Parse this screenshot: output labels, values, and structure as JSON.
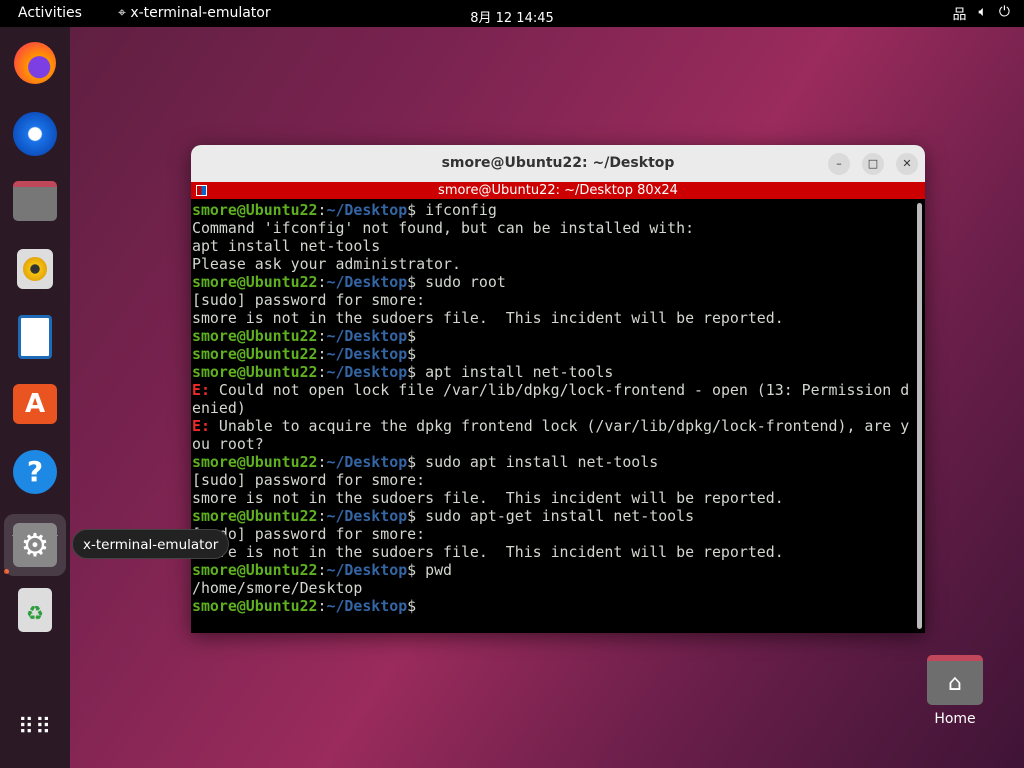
{
  "topbar": {
    "activities": "Activities",
    "app": "x-terminal-emulator",
    "clock": "8月 12 14:45",
    "tray": [
      "network-icon",
      "volume-icon",
      "power-icon"
    ]
  },
  "dock": {
    "items": [
      "firefox",
      "thunderbird",
      "files",
      "rhythmbox",
      "libreoffice-writer",
      "app-center",
      "help",
      "settings",
      "trash"
    ],
    "tooltip": "x-terminal-emulator",
    "apps_grid": "show-apps"
  },
  "window": {
    "title": "smore@Ubuntu22: ~/Desktop",
    "xterm_title": "smore@Ubuntu22: ~/Desktop 80x24",
    "min": "–",
    "max": "□",
    "close": "✕"
  },
  "terminal": {
    "lines": [
      [
        [
          "g",
          "smore@Ubuntu22"
        ],
        [
          "",
          "​:"
        ],
        [
          "b",
          "~/Desktop"
        ],
        [
          "",
          "$ ifconfig"
        ]
      ],
      [
        [
          "",
          "Command 'ifconfig' not found, but can be installed with:"
        ]
      ],
      [
        [
          "",
          "apt install net-tools"
        ]
      ],
      [
        [
          "",
          "Please ask your administrator."
        ]
      ],
      [
        [
          "g",
          "smore@Ubuntu22"
        ],
        [
          "",
          ":"
        ],
        [
          "b",
          "~/Desktop"
        ],
        [
          "",
          "$ sudo root"
        ]
      ],
      [
        [
          "",
          "[sudo] password for smore:"
        ]
      ],
      [
        [
          "",
          "smore is not in the sudoers file.  This incident will be reported."
        ]
      ],
      [
        [
          "g",
          "smore@Ubuntu22"
        ],
        [
          "",
          ":"
        ],
        [
          "b",
          "~/Desktop"
        ],
        [
          "",
          "$"
        ]
      ],
      [
        [
          "g",
          "smore@Ubuntu22"
        ],
        [
          "",
          ":"
        ],
        [
          "b",
          "~/Desktop"
        ],
        [
          "",
          "$"
        ]
      ],
      [
        [
          "g",
          "smore@Ubuntu22"
        ],
        [
          "",
          ":"
        ],
        [
          "b",
          "~/Desktop"
        ],
        [
          "",
          "$ apt install net-tools"
        ]
      ],
      [
        [
          "r",
          "E: "
        ],
        [
          "",
          "Could not open lock file /var/lib/dpkg/lock-frontend - open (13: Permission d"
        ]
      ],
      [
        [
          "",
          "enied)"
        ]
      ],
      [
        [
          "r",
          "E: "
        ],
        [
          "",
          "Unable to acquire the dpkg frontend lock (/var/lib/dpkg/lock-frontend), are y"
        ]
      ],
      [
        [
          "",
          "ou root?"
        ]
      ],
      [
        [
          "g",
          "smore@Ubuntu22"
        ],
        [
          "",
          ":"
        ],
        [
          "b",
          "~/Desktop"
        ],
        [
          "",
          "$ sudo apt install net-tools"
        ]
      ],
      [
        [
          "",
          "[sudo] password for smore:"
        ]
      ],
      [
        [
          "",
          "smore is not in the sudoers file.  This incident will be reported."
        ]
      ],
      [
        [
          "g",
          "smore@Ubuntu22"
        ],
        [
          "",
          ":"
        ],
        [
          "b",
          "~/Desktop"
        ],
        [
          "",
          "$ sudo apt-get install net-tools"
        ]
      ],
      [
        [
          "",
          "[sudo] password for smore:"
        ]
      ],
      [
        [
          "",
          "smore is not in the sudoers file.  This incident will be reported."
        ]
      ],
      [
        [
          "g",
          "smore@Ubuntu22"
        ],
        [
          "",
          ":"
        ],
        [
          "b",
          "~/Desktop"
        ],
        [
          "",
          "$ pwd"
        ]
      ],
      [
        [
          "",
          "/home/smore/Desktop"
        ]
      ],
      [
        [
          "g",
          "smore@Ubuntu22"
        ],
        [
          "",
          ":"
        ],
        [
          "b",
          "~/Desktop"
        ],
        [
          "",
          "$"
        ]
      ]
    ]
  },
  "desktop": {
    "home_label": "Home"
  }
}
